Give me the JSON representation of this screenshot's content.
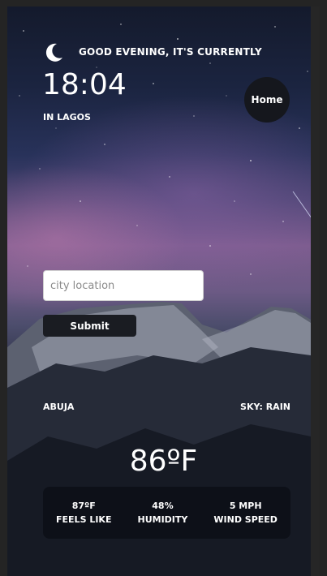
{
  "header": {
    "greeting": "GOOD EVENING, IT'S CURRENTLY",
    "time": "18:04",
    "location": "IN LAGOS",
    "home_label": "Home",
    "moon_icon": "crescent-moon-icon"
  },
  "search": {
    "placeholder": "city location",
    "value": "",
    "submit_label": "Submit"
  },
  "weather": {
    "city": "ABUJA",
    "sky": "SKY: RAIN",
    "temperature": "86ºF",
    "stats": [
      {
        "value": "87ºF",
        "label": "FEELS LIKE"
      },
      {
        "value": "48%",
        "label": "HUMIDITY"
      },
      {
        "value": "5 MPH",
        "label": "WIND SPEED"
      }
    ]
  },
  "colors": {
    "page_background": "#242424",
    "panel": "#15171d",
    "text": "#ffffff"
  }
}
